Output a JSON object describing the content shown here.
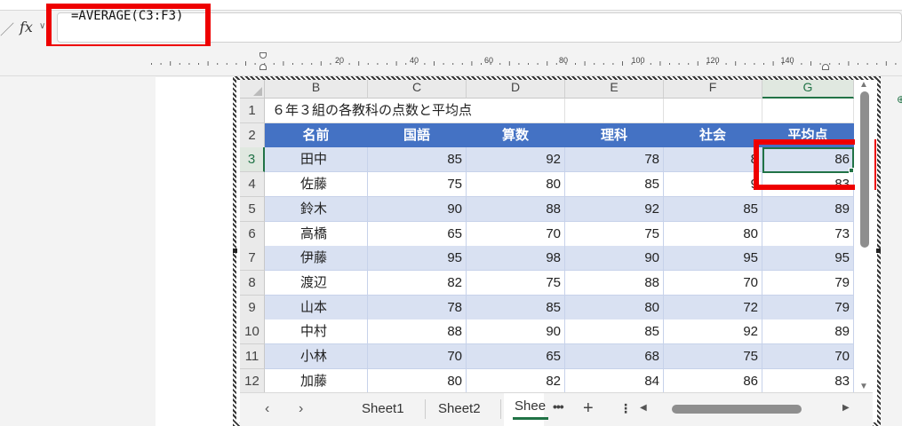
{
  "formula_bar": {
    "fx_label": "fx",
    "formula": "=AVERAGE(C3:F3)"
  },
  "ruler": {
    "labels": [
      "20",
      "40",
      "60",
      "80",
      "100",
      "120",
      "140"
    ]
  },
  "columns": [
    "B",
    "C",
    "D",
    "E",
    "F",
    "G"
  ],
  "active_column": "G",
  "rows": [
    "1",
    "2",
    "3",
    "4",
    "5",
    "6",
    "7",
    "8",
    "9",
    "10",
    "11",
    "12"
  ],
  "active_row": "3",
  "table": {
    "title": "６年３組の各教科の点数と平均点",
    "headers": [
      "名前",
      "国語",
      "算数",
      "理科",
      "社会",
      "平均点"
    ],
    "records": [
      [
        "田中",
        "85",
        "92",
        "78",
        "8",
        "86"
      ],
      [
        "佐藤",
        "75",
        "80",
        "85",
        "9",
        "83"
      ],
      [
        "鈴木",
        "90",
        "88",
        "92",
        "85",
        "89"
      ],
      [
        "高橋",
        "65",
        "70",
        "75",
        "80",
        "73"
      ],
      [
        "伊藤",
        "95",
        "98",
        "90",
        "95",
        "95"
      ],
      [
        "渡辺",
        "82",
        "75",
        "88",
        "70",
        "79"
      ],
      [
        "山本",
        "78",
        "85",
        "80",
        "72",
        "79"
      ],
      [
        "中村",
        "88",
        "90",
        "85",
        "92",
        "89"
      ],
      [
        "小林",
        "70",
        "65",
        "68",
        "75",
        "70"
      ],
      [
        "加藤",
        "80",
        "82",
        "84",
        "86",
        "83"
      ]
    ]
  },
  "sheet_tabs": {
    "tabs": [
      "Sheet1",
      "Sheet2"
    ],
    "active": "Shee",
    "more": "•••",
    "add": "+",
    "options": "⋮"
  },
  "colors": {
    "header_blue": "#4472c4",
    "band": "#d9e1f2",
    "select_green": "#217346",
    "highlight_red": "#ee0000"
  }
}
